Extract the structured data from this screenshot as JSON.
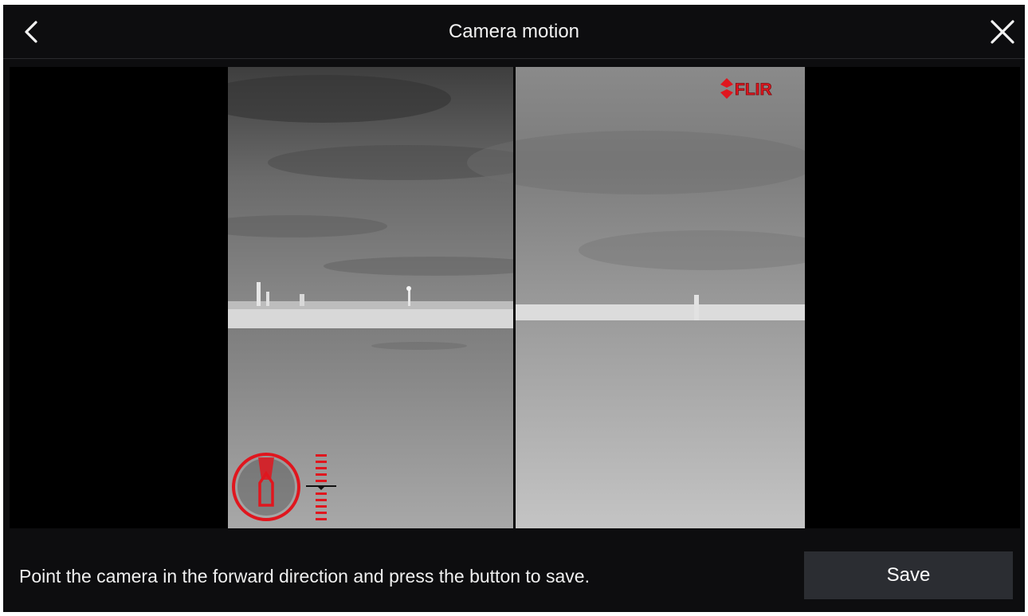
{
  "header": {
    "title": "Camera motion",
    "back_icon": "chevron-left-icon",
    "close_icon": "close-icon"
  },
  "camera_feed": {
    "brand_logo_text": "FLIR",
    "overlay_icon": "boat-heading-compass-icon",
    "accent_color": "#e0161e"
  },
  "footer": {
    "instruction": "Point the camera in the forward direction and press the button to save.",
    "save_label": "Save"
  }
}
